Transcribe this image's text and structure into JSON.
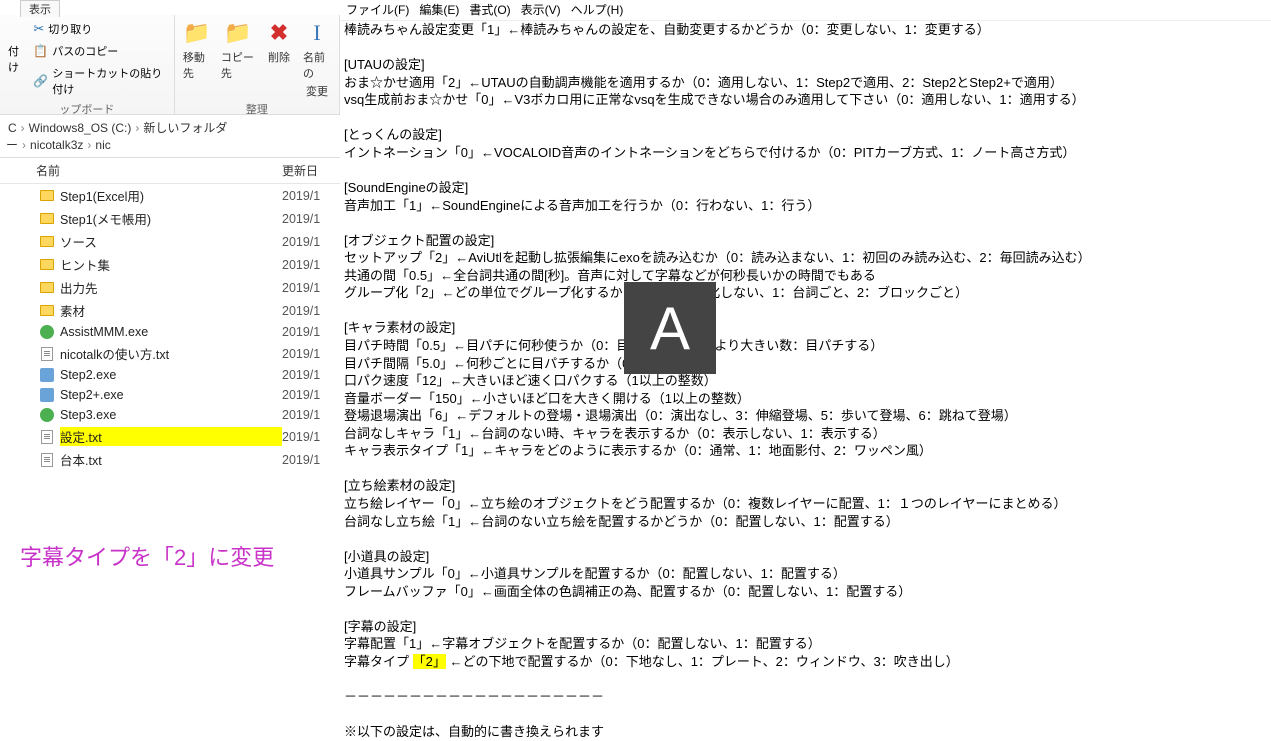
{
  "explorer": {
    "tab_label": "表示",
    "ribbon": {
      "clipboard": {
        "cut": "切り取り",
        "copy_path": "パスのコピー",
        "paste_shortcut": "ショートカットの貼り付け",
        "paste_suffix": "付け",
        "group": "ップボード"
      },
      "organize": {
        "move_to": "移動先",
        "copy_to": "コピー先",
        "delete": "削除",
        "rename_line1": "名前の",
        "rename_line2": "変更",
        "group": "整理"
      }
    },
    "breadcrumb": [
      "C",
      "Windows8_OS (C:)",
      "新しいフォルダー",
      "nicotalk3z",
      "nic"
    ],
    "columns": {
      "name": "名前",
      "date": "更新日"
    },
    "files": [
      {
        "name": "Step1(Excel用)",
        "type": "folder",
        "date": "2019/1"
      },
      {
        "name": "Step1(メモ帳用)",
        "type": "folder",
        "date": "2019/1"
      },
      {
        "name": "ソース",
        "type": "folder",
        "date": "2019/1"
      },
      {
        "name": "ヒント集",
        "type": "folder",
        "date": "2019/1"
      },
      {
        "name": "出力先",
        "type": "folder",
        "date": "2019/1"
      },
      {
        "name": "素材",
        "type": "folder",
        "date": "2019/1"
      },
      {
        "name": "AssistMMM.exe",
        "type": "exe-green",
        "date": "2019/1"
      },
      {
        "name": "nicotalkの使い方.txt",
        "type": "txt",
        "date": "2019/1"
      },
      {
        "name": "Step2.exe",
        "type": "exe",
        "date": "2019/1"
      },
      {
        "name": "Step2+.exe",
        "type": "exe",
        "date": "2019/1"
      },
      {
        "name": "Step3.exe",
        "type": "exe-green",
        "date": "2019/1"
      },
      {
        "name": "設定.txt",
        "type": "txt",
        "date": "2019/1",
        "selected": true
      },
      {
        "name": "台本.txt",
        "type": "txt",
        "date": "2019/1"
      }
    ],
    "caption": "字幕タイプを「2」に変更"
  },
  "notepad": {
    "menu": [
      "ファイル(F)",
      "編集(E)",
      "書式(O)",
      "表示(V)",
      "ヘルプ(H)"
    ],
    "lines": [
      "棒読みちゃん設定変更「1」←棒読みちゃんの設定を、自動変更するかどうか（0：変更しない、1：変更する）",
      "",
      "[UTAUの設定]",
      "おま☆かせ適用「2」←UTAUの自動調声機能を適用するか（0：適用しない、1：Step2で適用、2：Step2とStep2+で適用）",
      "vsq生成前おま☆かせ「0」←V3ボカロ用に正常なvsqを生成できない場合のみ適用して下さい（0：適用しない、1：適用する）",
      "",
      "[とっくんの設定]",
      "イントネーション「0」←VOCALOID音声のイントネーションをどちらで付けるか（0：PITカーブ方式、1：ノート高さ方式）",
      "",
      "[SoundEngineの設定]",
      "音声加工「1」←SoundEngineによる音声加工を行うか（0：行わない、1：行う）",
      "",
      "[オブジェクト配置の設定]",
      "セットアップ「2」←AviUtlを起動し拡張編集にexoを読み込むか（0：読み込まない、1：初回のみ読み込む、2：毎回読み込む）",
      "共通の間「0.5」←全台詞共通の間[秒]。音声に対して字幕などが何秒長いかの時間でもある",
      "グループ化「2」←どの単位でグループ化するか（0：グループ化しない、1：台詞ごと、2：ブロックごと）",
      "",
      "[キャラ素材の設定]",
      "目パチ時間「0.5」←目パチに何秒使うか（0：目パチしない、0より大きい数：目パチする）",
      "目パチ間隔「5.0」←何秒ごとに目パチするか（0より大きい数）",
      "口パク速度「12」←大きいほど速く口パクする（1以上の整数）",
      "音量ボーダー「150」←小さいほど口を大きく開ける（1以上の整数）",
      "登場退場演出「6」←デフォルトの登場・退場演出（0：演出なし、3：伸縮登場、5：歩いて登場、6：跳ねて登場）",
      "台詞なしキャラ「1」←台詞のない時、キャラを表示するか（0：表示しない、1：表示する）",
      "キャラ表示タイプ「1」←キャラをどのように表示するか（0：通常、1：地面影付、2：ワッペン風）",
      "",
      "[立ち絵素材の設定]",
      "立ち絵レイヤー「0」←立ち絵のオブジェクトをどう配置するか（0：複数レイヤーに配置、1：１つのレイヤーにまとめる）",
      "台詞なし立ち絵「1」←台詞のない立ち絵を配置するかどうか（0：配置しない、1：配置する）",
      "",
      "[小道具の設定]",
      "小道具サンプル「0」←小道具サンプルを配置するか（0：配置しない、1：配置する）",
      "フレームバッファ「0」←画面全体の色調補正の為、配置するか（0：配置しない、1：配置する）",
      "",
      "[字幕の設定]",
      "字幕配置「1」←字幕オブジェクトを配置するか（0：配置しない、1：配置する）",
      {
        "prefix": "字幕タイプ ",
        "highlight": "「2」",
        "suffix": " ←どの下地で配置するか（0：下地なし、1：プレート、2：ウィンドウ、3：吹き出し）"
      },
      "",
      "－－－－－－－－－－－－－－－－－－－－",
      "",
      "※以下の設定は、自動的に書き換えられます"
    ]
  },
  "ime": {
    "indicator": "A"
  }
}
